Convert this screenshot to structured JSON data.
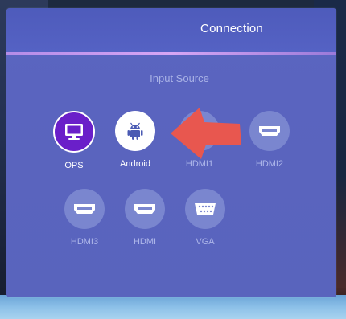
{
  "header": {
    "title": "Connection"
  },
  "section": {
    "title": "Input Source"
  },
  "sources": [
    {
      "label": "OPS",
      "icon": "monitor-icon",
      "state": "selected"
    },
    {
      "label": "Android",
      "icon": "android-icon",
      "state": "highlighted"
    },
    {
      "label": "HDMI1",
      "icon": "hdmi-icon",
      "state": "normal"
    },
    {
      "label": "HDMI2",
      "icon": "hdmi-icon",
      "state": "normal"
    },
    {
      "label": "HDMI3",
      "icon": "hdmi-icon",
      "state": "normal"
    },
    {
      "label": "HDMI",
      "icon": "hdmi-icon",
      "state": "normal"
    },
    {
      "label": "VGA",
      "icon": "vga-icon",
      "state": "normal"
    }
  ],
  "annotation": {
    "icon": "arrow-left-icon",
    "color": "#e8574f"
  },
  "colors": {
    "panel": "#5a64bf",
    "accent_line": "#c89af0",
    "ops_fill": "#6a1fc9"
  }
}
